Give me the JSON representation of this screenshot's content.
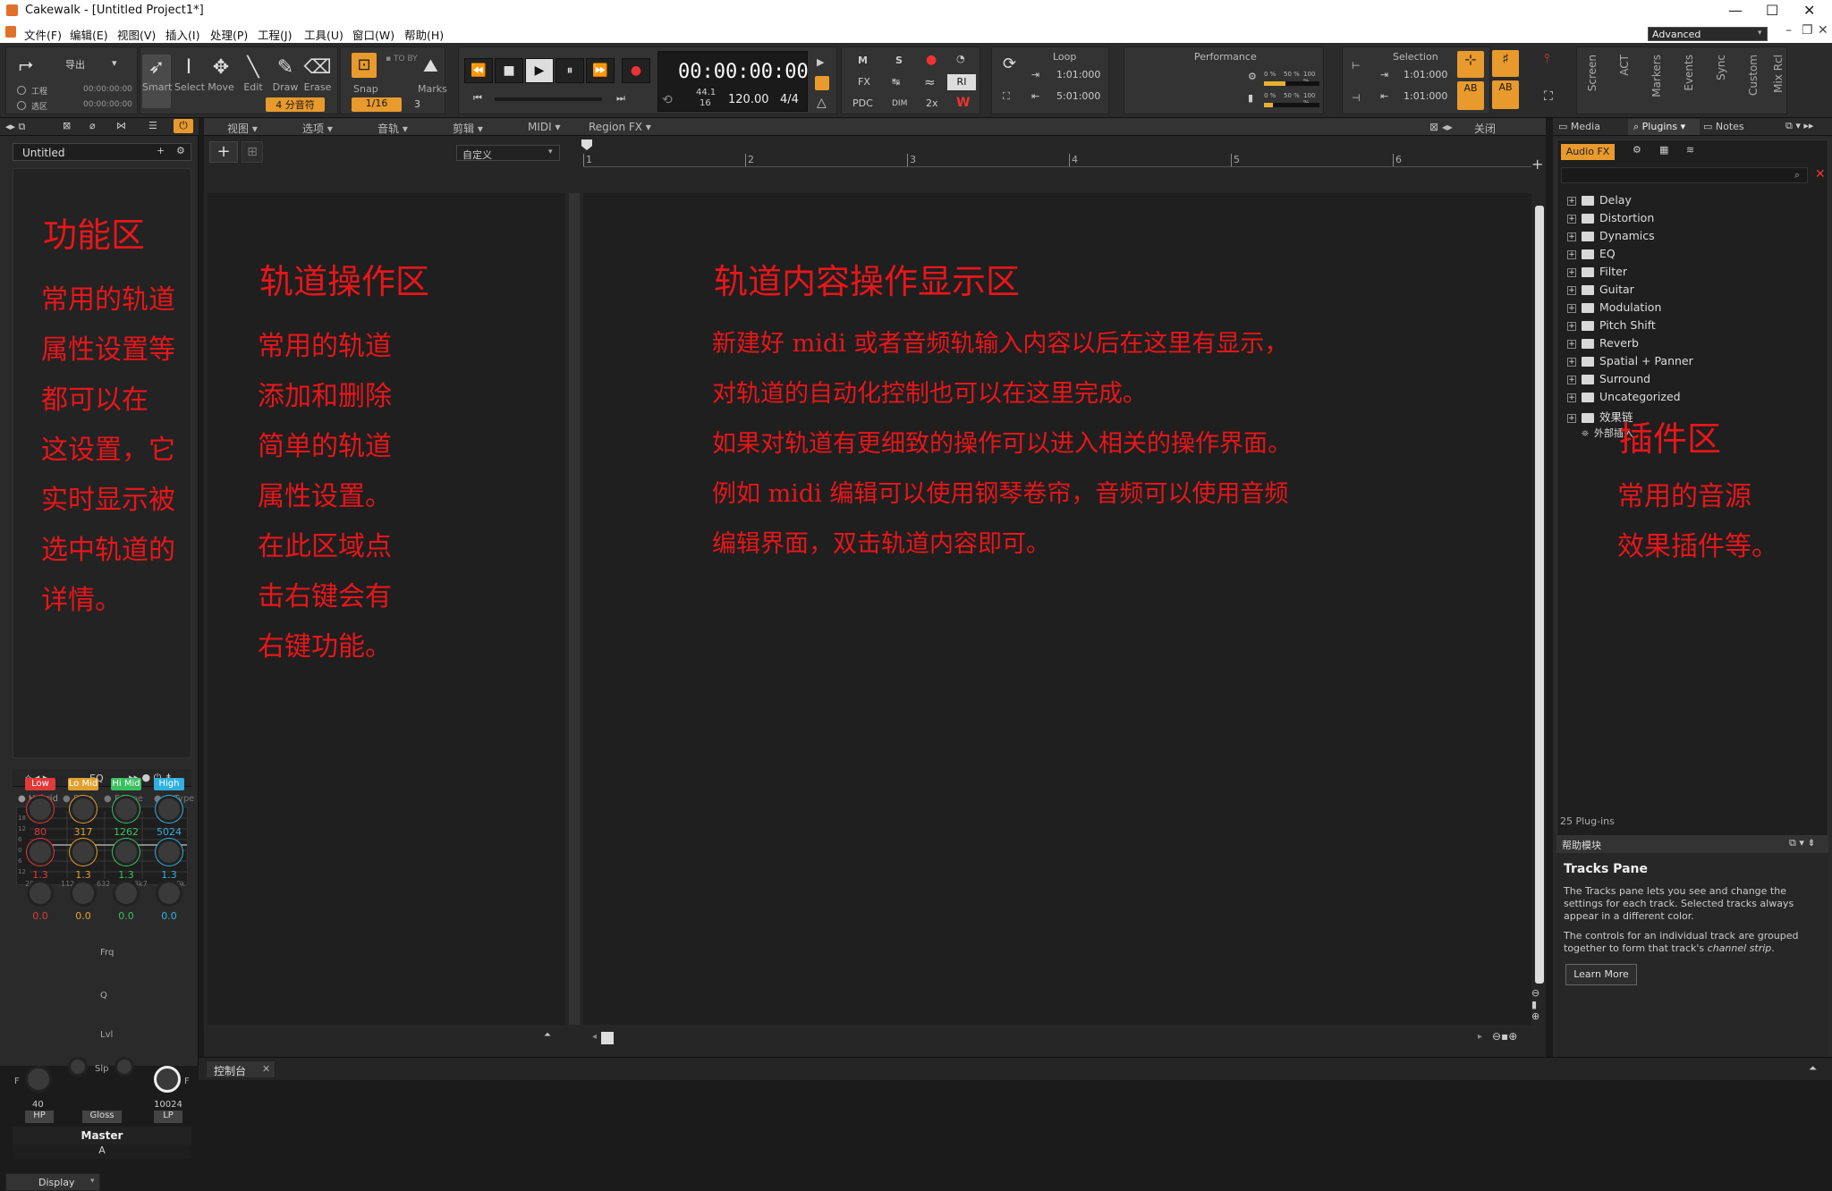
{
  "window": {
    "title": "Cakewalk - [Untitled Project1*]"
  },
  "menu": [
    "文件(F)",
    "编辑(E)",
    "视图(V)",
    "插入(I)",
    "处理(P)",
    "工程(J)",
    "工具(U)",
    "窗口(W)",
    "帮助(H)"
  ],
  "toolbar": {
    "export_label": "导出",
    "workspace_label": "工程",
    "selection_label": "选区",
    "time_a": "00:00:00:00",
    "time_b": "00:00:00:00",
    "tools": [
      "Smart",
      "Select",
      "Move",
      "Edit",
      "Draw",
      "Erase"
    ],
    "tool_badge": "4 分音符",
    "snap_label": "Snap",
    "snap_value": "1/16",
    "snap_extra": "3",
    "marks_label": "Marks",
    "transport_time": "00:00:00:00",
    "sample_rate": "44.1",
    "bit_depth": "16",
    "tempo": "120.00",
    "meter": "4/4",
    "mix_buttons": [
      "M",
      "S",
      "FX",
      "PDC",
      "DIM",
      "2x",
      "RI",
      "W"
    ],
    "loop_title": "Loop",
    "loop_start": "1:01:000",
    "loop_end": "5:01:000",
    "performance_title": "Performance",
    "perf_pct": [
      "0 %",
      "50 %",
      "100 %",
      "0 %",
      "50 %",
      "100 %"
    ],
    "selection_title": "Selection",
    "sel_start": "1:01:000",
    "sel_end": "1:01:000",
    "ab_labels": [
      "AB",
      "AB"
    ],
    "vertical_tabs": [
      "Screen",
      "ACT",
      "Markers",
      "Events",
      "Sync",
      "Custom",
      "Mix Rcl"
    ],
    "workspace_select": "Advanced"
  },
  "inspector": {
    "track_name": "Untitled",
    "eq_title": "EQ",
    "eq_modes": [
      "Hybrid",
      "Pure",
      "E-Type",
      "G-Type"
    ],
    "db_ticks": [
      "18",
      "12",
      "6",
      "0",
      "6",
      "12",
      "18"
    ],
    "freq_ticks": [
      "20",
      "112",
      "632",
      "3k7",
      "20k"
    ],
    "bands": [
      {
        "name": "Low",
        "color": "#e03a3a",
        "freq": "80",
        "q": "1.3",
        "lvl": "0.0"
      },
      {
        "name": "Lo Mid",
        "color": "#e0a030",
        "freq": "317",
        "q": "1.3",
        "lvl": "0.0"
      },
      {
        "name": "Hi Mid",
        "color": "#3ac060",
        "freq": "1262",
        "q": "1.3",
        "lvl": "0.0"
      },
      {
        "name": "High",
        "color": "#30b0e0",
        "freq": "5024",
        "q": "1.3",
        "lvl": "0.0"
      }
    ],
    "frq_label": "Frq",
    "q_label": "Q",
    "lvl_label": "Lvl",
    "slp_label": "Slp",
    "f_label": "F",
    "hp_value": "40",
    "lp_value": "10024",
    "hp": "HP",
    "gloss": "Gloss",
    "lp": "LP",
    "master": "Master",
    "bus_letter": "A",
    "display_tab": "Display"
  },
  "track_view": {
    "menus": [
      "视图",
      "选项",
      "音轨",
      "剪辑",
      "MIDI",
      "Region FX"
    ],
    "close": "关闭",
    "custom": "自定义",
    "ruler": [
      "1",
      "2",
      "3",
      "4",
      "5",
      "6"
    ]
  },
  "annotations": {
    "func_title": "功能区",
    "func_lines": [
      "常用的轨道",
      "属性设置等",
      "都可以在",
      "这设置，它",
      "实时显示被",
      "选中轨道的",
      "详情。"
    ],
    "track_title": "轨道操作区",
    "track_lines": [
      "常用的轨道",
      "添加和删除",
      "简单的轨道",
      "属性设置。",
      "在此区域点",
      "击右键会有",
      "右键功能。"
    ],
    "content_title": "轨道内容操作显示区",
    "content_lines": [
      "新建好 midi 或者音频轨输入内容以后在这里有显示，",
      "对轨道的自动化控制也可以在这里完成。",
      "如果对轨道有更细致的操作可以进入相关的操作界面。",
      "例如 midi 编辑可以使用钢琴卷帘，音频可以使用音频",
      "编辑界面，双击轨道内容即可。"
    ],
    "plugin_title": "插件区",
    "plugin_lines": [
      "常用的音源",
      "效果插件等。"
    ]
  },
  "browser": {
    "tabs": [
      "Media",
      "Plugins",
      "Notes"
    ],
    "audio_fx": "Audio FX",
    "tree": [
      "Delay",
      "Distortion",
      "Dynamics",
      "EQ",
      "Filter",
      "Guitar",
      "Modulation",
      "Pitch Shift",
      "Reverb",
      "Spatial + Panner",
      "Surround",
      "Uncategorized",
      "效果链"
    ],
    "external": "外部插入",
    "count": "25 Plug-ins"
  },
  "help": {
    "header": "帮助模块",
    "title": "Tracks Pane",
    "p1": "The Tracks pane lets you see and change the settings for each track. Selected tracks always appear in a different color.",
    "p2_pre": "The controls for an individual track are grouped together to form that track's ",
    "p2_em": "channel strip",
    "p2_post": ".",
    "learn_more": "Learn More"
  },
  "console_tab": "控制台"
}
